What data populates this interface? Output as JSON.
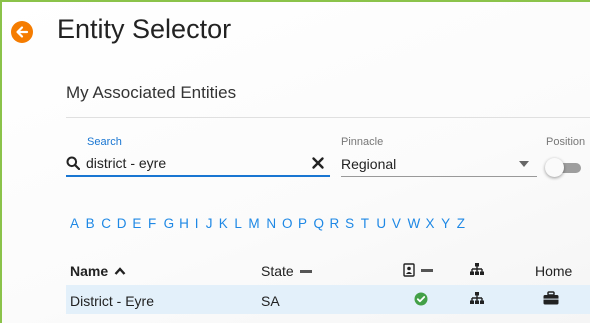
{
  "header": {
    "title": "Entity Selector"
  },
  "section": {
    "title": "My Associated Entities"
  },
  "filters": {
    "search_label": "Search",
    "search_value": "district - eyre",
    "pinnacle_label": "Pinnacle",
    "pinnacle_value": "Regional",
    "position_label": "Position"
  },
  "alphabet": [
    "A",
    "B",
    "C",
    "D",
    "E",
    "F",
    "G",
    "H",
    "I",
    "J",
    "K",
    "L",
    "M",
    "N",
    "O",
    "P",
    "Q",
    "R",
    "S",
    "T",
    "U",
    "V",
    "W",
    "X",
    "Y",
    "Z"
  ],
  "table": {
    "columns": {
      "name": "Name",
      "state": "State",
      "home": "Home"
    },
    "rows": [
      {
        "name": "District - Eyre",
        "state": "SA"
      }
    ]
  },
  "colors": {
    "accent": "#1976d2",
    "back_button": "#f57c00",
    "frame_border": "#8bc34a",
    "selected_row": "#e3f0fa",
    "check": "#43a047"
  }
}
